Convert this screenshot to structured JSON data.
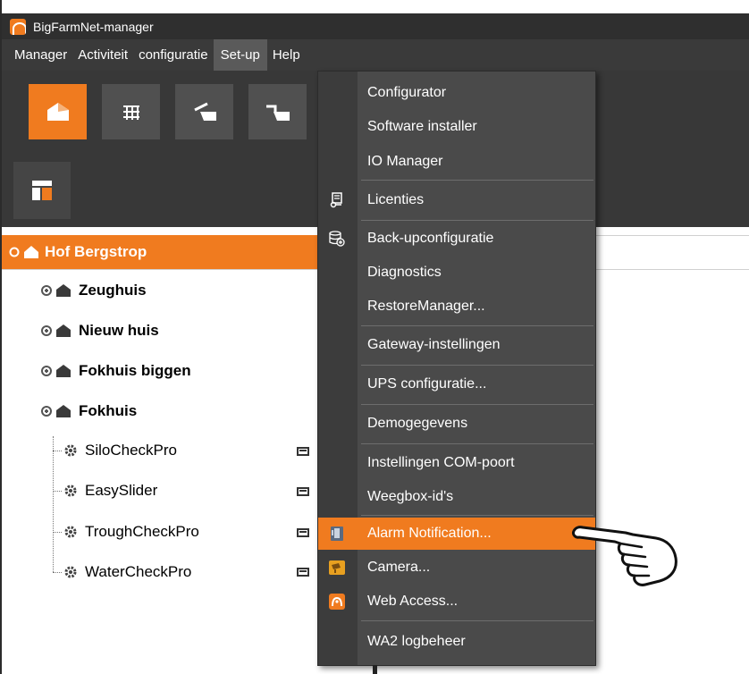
{
  "window": {
    "title": "BigFarmNet-manager"
  },
  "menubar": {
    "items": [
      "Manager",
      "Activiteit",
      "configuratie",
      "Set-up",
      "Help"
    ],
    "active": "Set-up"
  },
  "toolbar": {
    "buttons": [
      {
        "icon": "farm-house-icon",
        "active": true
      },
      {
        "icon": "grid-pen-icon",
        "active": false
      },
      {
        "icon": "feed-left-icon",
        "active": false
      },
      {
        "icon": "feed-right-icon",
        "active": false
      }
    ],
    "layout_button_icon": "layout-panel-icon"
  },
  "tree": {
    "root": "Hof Bergstrop",
    "houses": [
      "Zeughuis",
      "Nieuw huis",
      "Fokhuis biggen",
      "Fokhuis"
    ],
    "devices": [
      "SiloCheckPro",
      "EasySlider",
      "TroughCheckPro",
      "WaterCheckPro"
    ]
  },
  "setup_menu": {
    "items": [
      {
        "label": "Configurator",
        "icon": null
      },
      {
        "label": "Software installer",
        "icon": null
      },
      {
        "label": "IO Manager",
        "icon": null
      },
      {
        "label": "Licenties",
        "icon": "license-icon"
      },
      {
        "label": "Back-upconfiguratie",
        "icon": "database-backup-icon"
      },
      {
        "label": "Diagnostics",
        "icon": null
      },
      {
        "label": "RestoreManager...",
        "icon": null
      },
      {
        "label": "Gateway-instellingen",
        "icon": null
      },
      {
        "label": "UPS configuratie...",
        "icon": null
      },
      {
        "label": "Demogegevens",
        "icon": null
      },
      {
        "label": "Instellingen COM-poort",
        "icon": null
      },
      {
        "label": "Weegbox-id's",
        "icon": null
      },
      {
        "label": "Alarm Notification...",
        "icon": "phone-alarm-icon",
        "highlighted": true
      },
      {
        "label": "Camera...",
        "icon": "camera-icon"
      },
      {
        "label": "Web Access...",
        "icon": "web-access-icon"
      },
      {
        "label": "WA2 logbeheer",
        "icon": null
      }
    ]
  },
  "colors": {
    "accent": "#f07b1f",
    "menu_bg": "#4a4a4a",
    "toolbar_bg": "#383838",
    "titlebar_bg": "#2f2f2f"
  }
}
